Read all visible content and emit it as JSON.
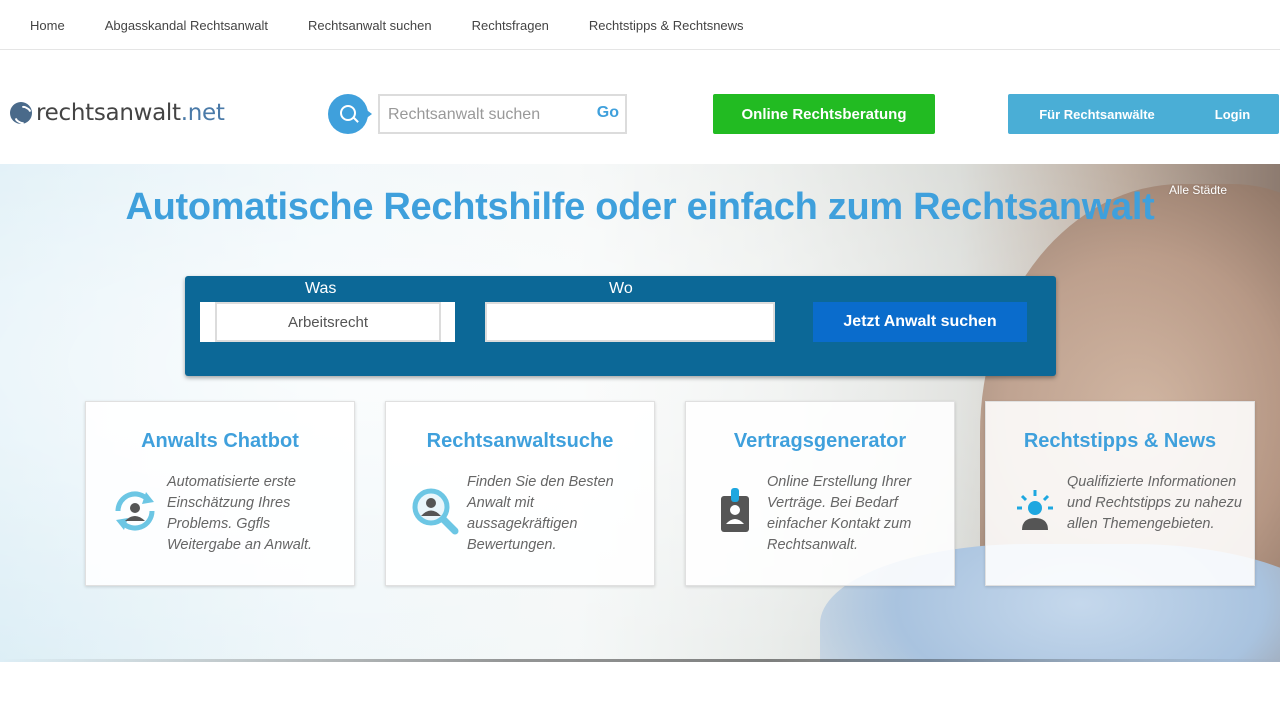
{
  "topnav": {
    "items": [
      {
        "label": "Home"
      },
      {
        "label": "Abgasskandal Rechtsanwalt"
      },
      {
        "label": "Rechtsanwalt suchen"
      },
      {
        "label": "Rechtsfragen"
      },
      {
        "label": "Rechtstipps & Rechtsnews"
      }
    ]
  },
  "header": {
    "logo_name": "rechtsanwalt",
    "logo_tld": ".net",
    "search_placeholder": "Rechtsanwalt suchen",
    "search_go": "Go",
    "online_button": "Online Rechtsberatung",
    "lawyers_button": "Für Rechtsanwälte",
    "login_button": "Login"
  },
  "hero": {
    "title": "Automatische Rechtshilfe oder einfach zum Rechtsanwalt",
    "all_cities": "Alle Städte",
    "form": {
      "was_label": "Was",
      "was_value": "Arbeitsrecht",
      "wo_label": "Wo",
      "wo_value": "",
      "submit": "Jetzt Anwalt suchen"
    }
  },
  "cards": [
    {
      "title": "Anwalts Chatbot",
      "text": "Automatisierte erste Einschätzung Ihres Problems. Ggfls Weitergabe an Anwalt.",
      "icon": "chatbot-icon"
    },
    {
      "title": "Rechtsanwaltsuche",
      "text": "Finden Sie den Besten Anwalt mit aussagekräftigen Bewertungen.",
      "icon": "lawyer-search-icon"
    },
    {
      "title": "Vertragsgenerator",
      "text": "Online Erstellung Ihrer Verträge. Bei Bedarf einfacher Kontakt zum Rechtsanwalt.",
      "icon": "contract-badge-icon"
    },
    {
      "title": "Rechtstipps & News",
      "text": "Qualifizierte Informationen und Rechtstipps zu nahezu allen Themengebieten.",
      "icon": "idea-person-icon"
    }
  ],
  "colors": {
    "accent_blue": "#3fa0dc",
    "panel_blue": "#0c6897",
    "button_blue": "#0a6ccc",
    "green": "#22bb22",
    "light_blue": "#4aaed6"
  }
}
